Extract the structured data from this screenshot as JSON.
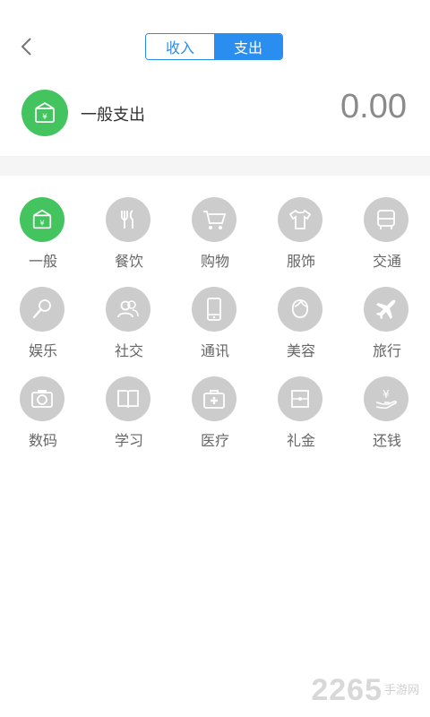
{
  "header": {
    "back_icon": "chevron-left-icon",
    "tabs": [
      {
        "label": "收入",
        "active": false
      },
      {
        "label": "支出",
        "active": true
      }
    ]
  },
  "summary": {
    "selected_category": "一般支出",
    "amount": "0.00",
    "icon": "money-envelope-icon"
  },
  "colors": {
    "accent": "#2a8ef0",
    "selected": "#43c45e",
    "icon_bg": "#cccccc"
  },
  "categories": [
    {
      "label": "一般",
      "icon": "money-envelope-icon",
      "active": true
    },
    {
      "label": "餐饮",
      "icon": "fork-knife-icon",
      "active": false
    },
    {
      "label": "购物",
      "icon": "cart-icon",
      "active": false
    },
    {
      "label": "服饰",
      "icon": "shirt-icon",
      "active": false
    },
    {
      "label": "交通",
      "icon": "bus-icon",
      "active": false
    },
    {
      "label": "娱乐",
      "icon": "microphone-icon",
      "active": false
    },
    {
      "label": "社交",
      "icon": "people-icon",
      "active": false
    },
    {
      "label": "通讯",
      "icon": "phone-icon",
      "active": false
    },
    {
      "label": "美容",
      "icon": "face-icon",
      "active": false
    },
    {
      "label": "旅行",
      "icon": "airplane-icon",
      "active": false
    },
    {
      "label": "数码",
      "icon": "camera-icon",
      "active": false
    },
    {
      "label": "学习",
      "icon": "book-icon",
      "active": false
    },
    {
      "label": "医疗",
      "icon": "medical-kit-icon",
      "active": false
    },
    {
      "label": "礼金",
      "icon": "gift-envelope-icon",
      "active": false
    },
    {
      "label": "还钱",
      "icon": "hand-money-icon",
      "active": false
    }
  ],
  "watermark": {
    "number": "2265",
    "text": "手游网"
  }
}
